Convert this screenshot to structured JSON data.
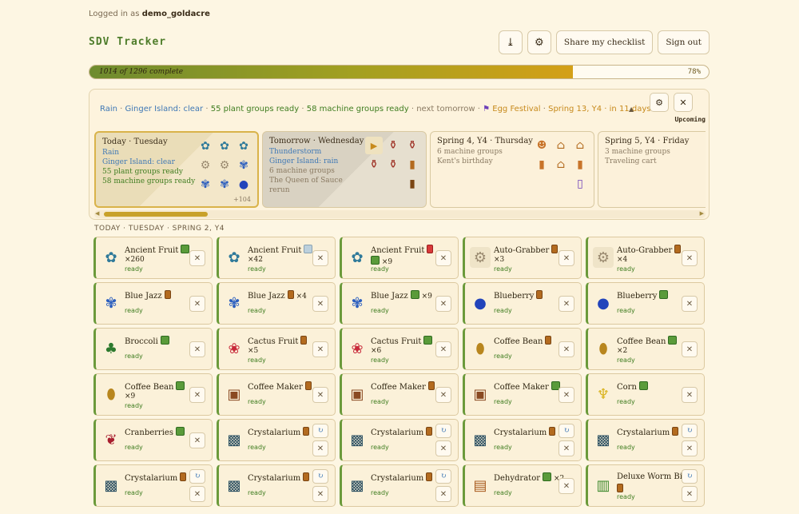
{
  "header": {
    "login_prefix": "Logged in as",
    "username": "demo_goldacre",
    "brand": "SDV Tracker",
    "share_label": "Share my checklist",
    "signout_label": "Sign out"
  },
  "progress": {
    "text": "1014 of 1296 complete",
    "pct_label": "78%",
    "fraction": 0.78
  },
  "forecast": {
    "weather": "Rain",
    "island": "Ginger Island: clear",
    "plants": "55 plant groups ready",
    "machines": "58 machine groups ready",
    "next_prefix": "next tomorrow",
    "festival": "Egg Festival",
    "festival_when": "Spring 13, Y4 · in 11 days",
    "upcoming_label": "Upcoming"
  },
  "days": [
    {
      "title": "Today · Tuesday",
      "l1": "Rain",
      "l2": "Ginger Island: clear",
      "l3": "55 plant groups ready",
      "l4": "58 machine groups ready",
      "more": "+104"
    },
    {
      "title": "Tomorrow · Wednesday",
      "l1": "Thunderstorm",
      "l2": "Ginger Island: rain",
      "l3": "6 machine groups",
      "l4": "The Queen of Sauce",
      "l5": "rerun"
    },
    {
      "title": "Spring 4, Y4 · Thursday",
      "l1": "6 machine groups",
      "l2": "Kent's birthday"
    },
    {
      "title": "Spring 5, Y4 · Friday",
      "l1": "3 machine groups",
      "l2": "Traveling cart"
    }
  ],
  "section_title": "TODAY · TUESDAY · SPRING 2, Y4",
  "ready_label": "ready",
  "cards": [
    {
      "name": "Ancient Fruit",
      "sub": "×260",
      "icon": "ancient-fruit-icon"
    },
    {
      "name": "Ancient Fruit",
      "sub": "×42",
      "icon": "ancient-fruit-icon"
    },
    {
      "name": "Ancient Fruit",
      "sub": "×9",
      "icon": "ancient-fruit-icon"
    },
    {
      "name": "Auto-Grabber",
      "sub": "×3",
      "icon": "gear-icon"
    },
    {
      "name": "Auto-Grabber",
      "sub": "×4",
      "icon": "gear-icon"
    },
    {
      "name": "Blue Jazz",
      "sub": "",
      "icon": "blue-jazz-icon"
    },
    {
      "name": "Blue Jazz",
      "mult": "×4",
      "icon": "blue-jazz-icon"
    },
    {
      "name": "Blue Jazz",
      "mult": "×9",
      "icon": "blue-jazz-icon"
    },
    {
      "name": "Blueberry",
      "sub": "",
      "icon": "blueberry-icon"
    },
    {
      "name": "Blueberry",
      "sub": "",
      "icon": "blueberry-icon"
    },
    {
      "name": "Broccoli",
      "sub": "",
      "icon": "broccoli-icon"
    },
    {
      "name": "Cactus Fruit",
      "sub": "×5",
      "icon": "cactus-fruit-icon"
    },
    {
      "name": "Cactus Fruit",
      "sub": "×6",
      "icon": "cactus-fruit-icon"
    },
    {
      "name": "Coffee Bean",
      "sub": "",
      "icon": "coffee-bean-icon"
    },
    {
      "name": "Coffee Bean",
      "sub": "×2",
      "icon": "coffee-bean-icon"
    },
    {
      "name": "Coffee Bean",
      "sub": "×9",
      "icon": "coffee-bean-icon"
    },
    {
      "name": "Coffee Maker",
      "sub": "",
      "icon": "coffee-maker-icon"
    },
    {
      "name": "Coffee Maker",
      "sub": "",
      "icon": "coffee-maker-icon"
    },
    {
      "name": "Coffee Maker",
      "sub": "",
      "icon": "coffee-maker-icon"
    },
    {
      "name": "Corn",
      "sub": "",
      "icon": "corn-icon"
    },
    {
      "name": "Cranberries",
      "sub": "",
      "icon": "cranberries-icon"
    },
    {
      "name": "Crystalarium",
      "sub": "",
      "icon": "crystalarium-icon"
    },
    {
      "name": "Crystalarium",
      "sub": "",
      "icon": "crystalarium-icon"
    },
    {
      "name": "Crystalarium",
      "sub": "",
      "icon": "crystalarium-icon"
    },
    {
      "name": "Crystalarium",
      "sub": "",
      "icon": "crystalarium-icon"
    },
    {
      "name": "Crystalarium",
      "sub": "",
      "icon": "crystalarium-icon"
    },
    {
      "name": "Crystalarium",
      "sub": "",
      "icon": "crystalarium-icon"
    },
    {
      "name": "Crystalarium",
      "sub": "",
      "icon": "crystalarium-icon"
    },
    {
      "name": "Dehydrator",
      "mult": "×2",
      "icon": "dehydrator-icon"
    },
    {
      "name": "Deluxe Worm Bin",
      "sub": "",
      "icon": "worm-bin-icon"
    }
  ],
  "colors": {
    "accent_green": "#4f7d2b",
    "gold": "#d4a017",
    "ready_green": "#3f7d20"
  }
}
